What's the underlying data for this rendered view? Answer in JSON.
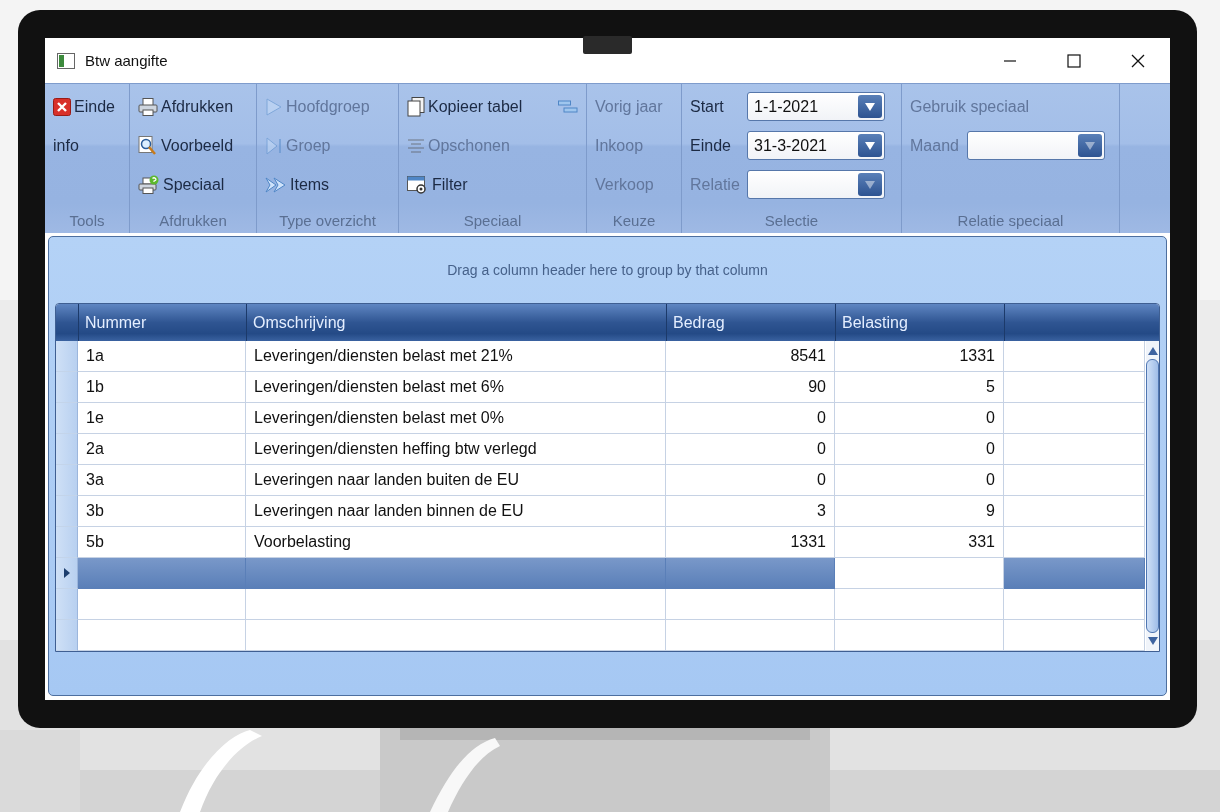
{
  "window": {
    "title": "Btw aangifte"
  },
  "ribbon": {
    "tools": {
      "label": "Tools",
      "items": [
        {
          "label": "Einde",
          "disabled": false
        },
        {
          "label": "info",
          "disabled": false
        }
      ]
    },
    "afdrukken": {
      "label": "Afdrukken",
      "items": [
        {
          "label": "Afdrukken",
          "disabled": false
        },
        {
          "label": "Voorbeeld",
          "disabled": false
        },
        {
          "label": "Speciaal",
          "disabled": false
        }
      ]
    },
    "type_overzicht": {
      "label": "Type overzicht",
      "items": [
        {
          "label": "Hoofdgroep",
          "disabled": true
        },
        {
          "label": "Groep",
          "disabled": true
        },
        {
          "label": "Items",
          "disabled": false
        }
      ]
    },
    "speciaal": {
      "label": "Speciaal",
      "items": [
        {
          "label": "Kopieer tabel",
          "disabled": false
        },
        {
          "label": "Opschonen",
          "disabled": true
        },
        {
          "label": "Filter",
          "disabled": false
        }
      ]
    },
    "keuze": {
      "label": "Keuze",
      "items": [
        {
          "label": "Vorig jaar",
          "disabled": true
        },
        {
          "label": "Inkoop",
          "disabled": true
        },
        {
          "label": "Verkoop",
          "disabled": true
        }
      ]
    },
    "selectie": {
      "label": "Selectie",
      "fields": [
        {
          "label": "Start",
          "value": "1-1-2021",
          "disabled": false
        },
        {
          "label": "Einde",
          "value": "31-3-2021",
          "disabled": false
        },
        {
          "label": "Relatie",
          "disabled": true
        }
      ]
    },
    "relatie_speciaal": {
      "label": "Relatie speciaal",
      "checkbox_label": "Gebruik speciaal",
      "checkbox_disabled": true,
      "field": {
        "label": "Maand",
        "disabled": true
      }
    }
  },
  "grid": {
    "group_hint": "Drag a column header here to group by that column",
    "columns": [
      "Nummer",
      "Omschrijving",
      "Bedrag",
      "Belasting"
    ],
    "rows": [
      {
        "nummer": "1a",
        "omschrijving": "Leveringen/diensten belast met 21%",
        "bedrag": "8541",
        "belasting": "1331",
        "selected": false
      },
      {
        "nummer": "1b",
        "omschrijving": "Leveringen/diensten belast met 6%",
        "bedrag": "90",
        "belasting": "5",
        "selected": false
      },
      {
        "nummer": "1e",
        "omschrijving": "Leveringen/diensten belast met 0%",
        "bedrag": "0",
        "belasting": "0",
        "selected": false
      },
      {
        "nummer": "2a",
        "omschrijving": "Leveringen/diensten heffing btw verlegd",
        "bedrag": "0",
        "belasting": "0",
        "selected": false
      },
      {
        "nummer": "3a",
        "omschrijving": "Leveringen naar landen buiten de EU",
        "bedrag": "0",
        "belasting": "0",
        "selected": false
      },
      {
        "nummer": "3b",
        "omschrijving": "Leveringen naar landen binnen de EU",
        "bedrag": "3",
        "belasting": "9",
        "selected": false
      },
      {
        "nummer": "5b",
        "omschrijving": "Voorbelasting",
        "bedrag": "1331",
        "belasting": "331",
        "selected": false
      },
      {
        "selected": true
      },
      {
        "selected": false
      },
      {
        "selected": false
      }
    ]
  }
}
